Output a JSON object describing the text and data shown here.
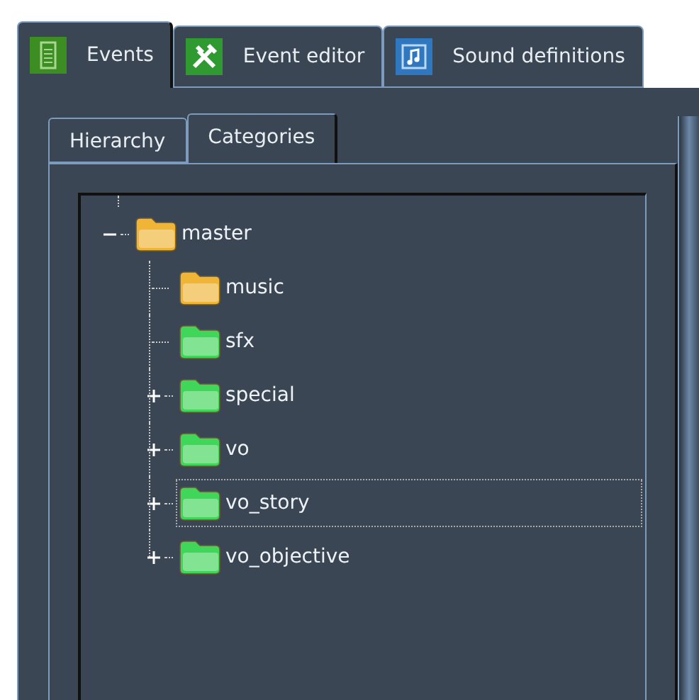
{
  "tabs": [
    {
      "label": "Events",
      "selected": true,
      "kind": "list"
    },
    {
      "label": "Event editor",
      "selected": false,
      "kind": "tools"
    },
    {
      "label": "Sound definitions",
      "selected": false,
      "kind": "music"
    }
  ],
  "subtabs": [
    {
      "label": "Hierarchy",
      "selected": false
    },
    {
      "label": "Categories",
      "selected": true
    }
  ],
  "tree": [
    {
      "label": "master",
      "color": "#f0b437",
      "expanded": true,
      "selected": false,
      "children": [
        {
          "label": "music",
          "color": "#f0b437",
          "selected": false
        },
        {
          "label": "sfx",
          "color": "#3fd65a",
          "selected": false
        },
        {
          "label": "special",
          "color": "#3fd65a",
          "expanded": false,
          "selected": false
        },
        {
          "label": "vo",
          "color": "#3fd65a",
          "expanded": false,
          "selected": false
        },
        {
          "label": "vo_story",
          "color": "#3fd65a",
          "expanded": false,
          "selected": true
        },
        {
          "label": "vo_objective",
          "color": "#3fd65a",
          "expanded": false,
          "selected": false
        }
      ]
    }
  ]
}
